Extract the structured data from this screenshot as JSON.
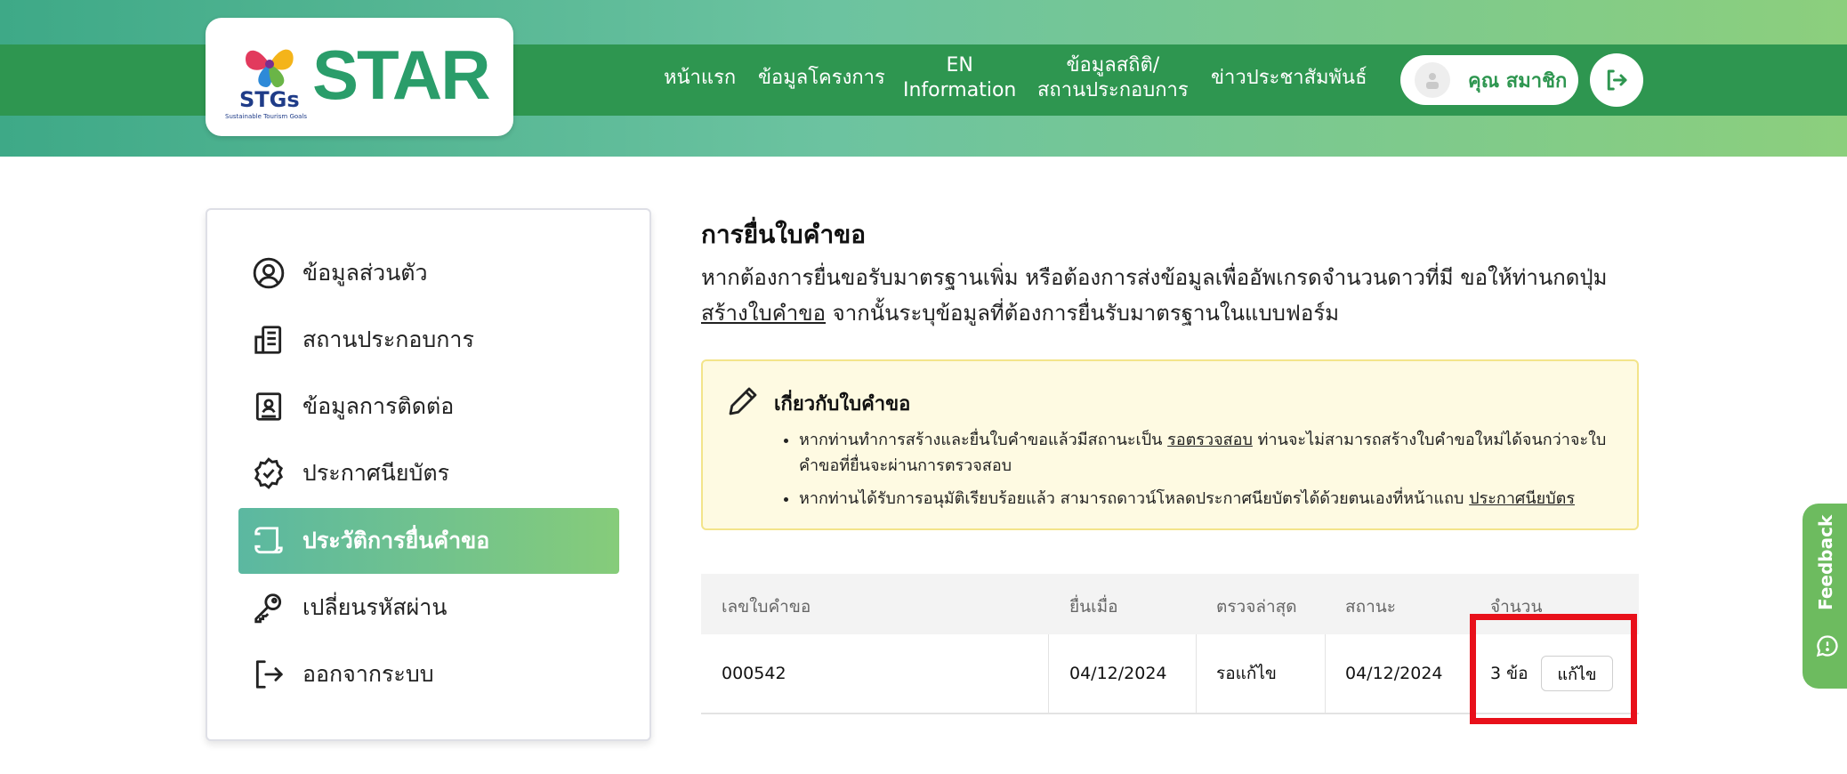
{
  "header": {
    "logo_text": "STAR",
    "logo_sub": "STGs",
    "logo_caption": "Sustainable Tourism Goals",
    "nav": [
      {
        "label": "หน้าแรก"
      },
      {
        "label": "ข้อมูลโครงการ"
      },
      {
        "label_line1": "EN",
        "label_line2": "Information"
      },
      {
        "label_line1": "ข้อมูลสถิติ/",
        "label_line2": "สถานประกอบการ"
      },
      {
        "label": "ข่าวประชาสัมพันธ์"
      }
    ],
    "user_name": "คุณ สมาชิก"
  },
  "sidebar": {
    "items": [
      {
        "label": "ข้อมูลส่วนตัว",
        "icon": "user-circle-icon"
      },
      {
        "label": "สถานประกอบการ",
        "icon": "building-icon"
      },
      {
        "label": "ข้อมูลการติดต่อ",
        "icon": "contact-book-icon"
      },
      {
        "label": "ประกาศนียบัตร",
        "icon": "certificate-badge-icon"
      },
      {
        "label": "ประวัติการยื่นคำขอ",
        "icon": "scroll-icon",
        "active": true
      },
      {
        "label": "เปลี่ยนรหัสผ่าน",
        "icon": "key-icon"
      },
      {
        "label": "ออกจากระบบ",
        "icon": "logout-icon"
      }
    ]
  },
  "main": {
    "title": "การยื่นใบคำขอ",
    "desc_part1": "หากต้องการยื่นขอรับมาตรฐานเพิ่ม หรือต้องการส่งข้อมูลเพื่ออัพเกรดจำนวนดาวที่มี ขอให้ท่านกดปุ่ม",
    "desc_link": "สร้างใบคำขอ",
    "desc_part2": " จากนั้นระบุข้อมูลที่ต้องการยื่นรับมาตรฐานในแบบฟอร์ม",
    "notice": {
      "title": "เกี่ยวกับใบคำขอ",
      "item1_part1": "หากท่านทำการสร้างและยื่นใบคำขอแล้วมีสถานะเป็น ",
      "item1_link": "รอตรวจสอบ",
      "item1_part2": " ท่านจะไม่สามารถสร้างใบคำขอใหม่ได้จนกว่าจะใบคำขอที่ยื่นจะผ่านการตรวจสอบ",
      "item2_part1": "หากท่านได้รับการอนุมัติเรียบร้อยแล้ว สามารถดาวน์โหลดประกาศนียบัตรได้ด้วยตนเองที่หน้าแถบ ",
      "item2_link": "ประกาศนียบัตร"
    },
    "table": {
      "headers": [
        "เลขใบคำขอ",
        "ยื่นเมื่อ",
        "ตรวจล่าสุด",
        "สถานะ",
        "จำนวน"
      ],
      "rows": [
        {
          "id": "000542",
          "submitted": "04/12/2024",
          "last_checked": "รอแก้ไข",
          "status": "04/12/2024",
          "count": "3 ข้อ",
          "action": "แก้ไข"
        }
      ]
    }
  },
  "feedback": {
    "label": "Feedback"
  },
  "colors": {
    "brand_green": "#2e9650",
    "highlight_red": "#e8101a",
    "notice_bg": "#fefae2"
  }
}
